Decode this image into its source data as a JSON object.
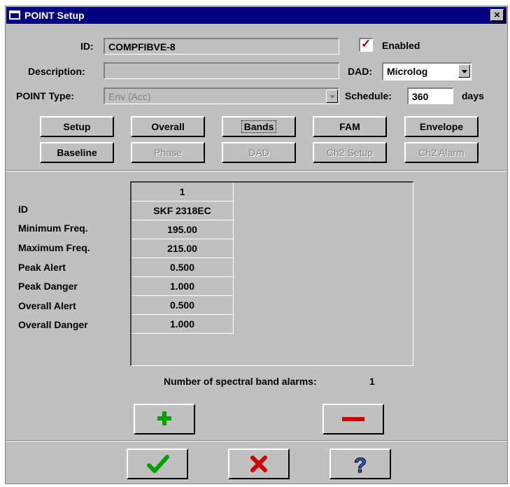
{
  "window": {
    "title": "POINT Setup",
    "close_glyph": "×"
  },
  "form": {
    "id_label": "ID:",
    "id_value": "COMPFIBVE-8",
    "enabled_label": "Enabled",
    "enabled_checked": true,
    "description_label": "Description:",
    "description_value": "",
    "dad_label": "DAD:",
    "dad_value": "Microlog",
    "point_type_label": "POINT Type:",
    "point_type_value": "Env (Acc)",
    "schedule_label": "Schedule:",
    "schedule_value": "360",
    "schedule_unit": "days"
  },
  "tabs_row1": [
    "Setup",
    "Overall",
    "Bands",
    "FAM",
    "Envelope"
  ],
  "tabs_row2": [
    "Baseline",
    "Phase",
    "DAD",
    "Ch2 Setup",
    "Ch2 Alarm"
  ],
  "bands": {
    "column_header": "1",
    "row_labels": [
      "ID",
      "Minimum Freq.",
      "Maximum Freq.",
      "Peak Alert",
      "Peak Danger",
      "Overall Alert",
      "Overall Danger"
    ],
    "values": [
      "SKF 2318EC",
      "195.00",
      "215.00",
      "0.500",
      "1.000",
      "0.500",
      "1.000"
    ],
    "count_label": "Number of spectral band alarms:",
    "count_value": "1"
  },
  "icons": {
    "add": "plus-icon",
    "remove": "minus-icon",
    "ok": "checkmark-icon",
    "cancel": "x-icon",
    "help": "question-icon"
  },
  "colors": {
    "titlebar": "#000080",
    "dialog": "#c0c0c0",
    "plus": "#00a000",
    "minus": "#d00000",
    "ok": "#00a000",
    "cancel": "#d00000",
    "help": "#2060e0"
  }
}
